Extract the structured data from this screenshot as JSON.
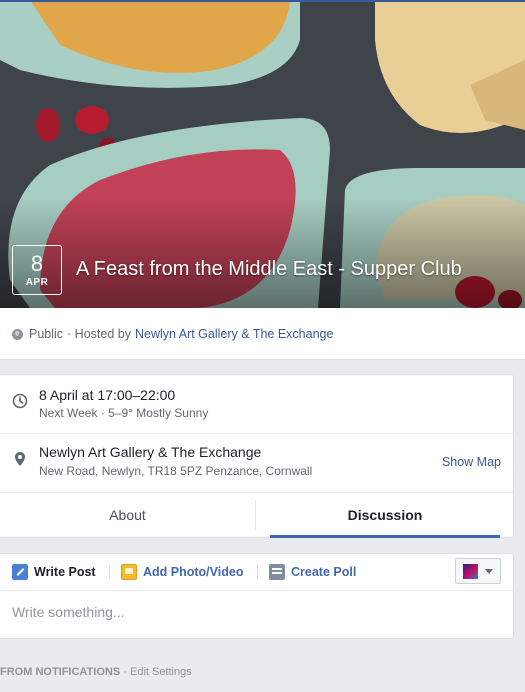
{
  "cover": {
    "date_day": "8",
    "date_month": "APR",
    "title": "A Feast from the Middle East - Supper Club"
  },
  "host": {
    "privacy": "Public",
    "hosted_by_prefix": "· Hosted by",
    "host_name": "Newlyn Art Gallery & The Exchange"
  },
  "details": {
    "time_primary": "8 April at 17:00–22:00",
    "time_secondary": "Next Week · 5–9° Mostly Sunny",
    "location_primary": "Newlyn Art Gallery & The Exchange",
    "location_secondary": "New Road, Newlyn, TR18 5PZ Penzance, Cornwall",
    "show_map": "Show Map"
  },
  "tabs": {
    "about": "About",
    "discussion": "Discussion",
    "active": "discussion"
  },
  "composer": {
    "write_post": "Write Post",
    "add_photo": "Add Photo/Video",
    "create_poll": "Create Poll",
    "placeholder": "Write something..."
  },
  "notifications": {
    "label": "FROM NOTIFICATIONS",
    "separator": "·",
    "edit_settings": "Edit Settings"
  },
  "colors": {
    "link": "#365899",
    "accent": "#4267b2",
    "background": "#e9ebee"
  },
  "icons": [
    "globe-icon",
    "clock-icon",
    "location-pin-icon",
    "pencil-icon",
    "photo-icon",
    "poll-icon",
    "chevron-down-icon"
  ]
}
